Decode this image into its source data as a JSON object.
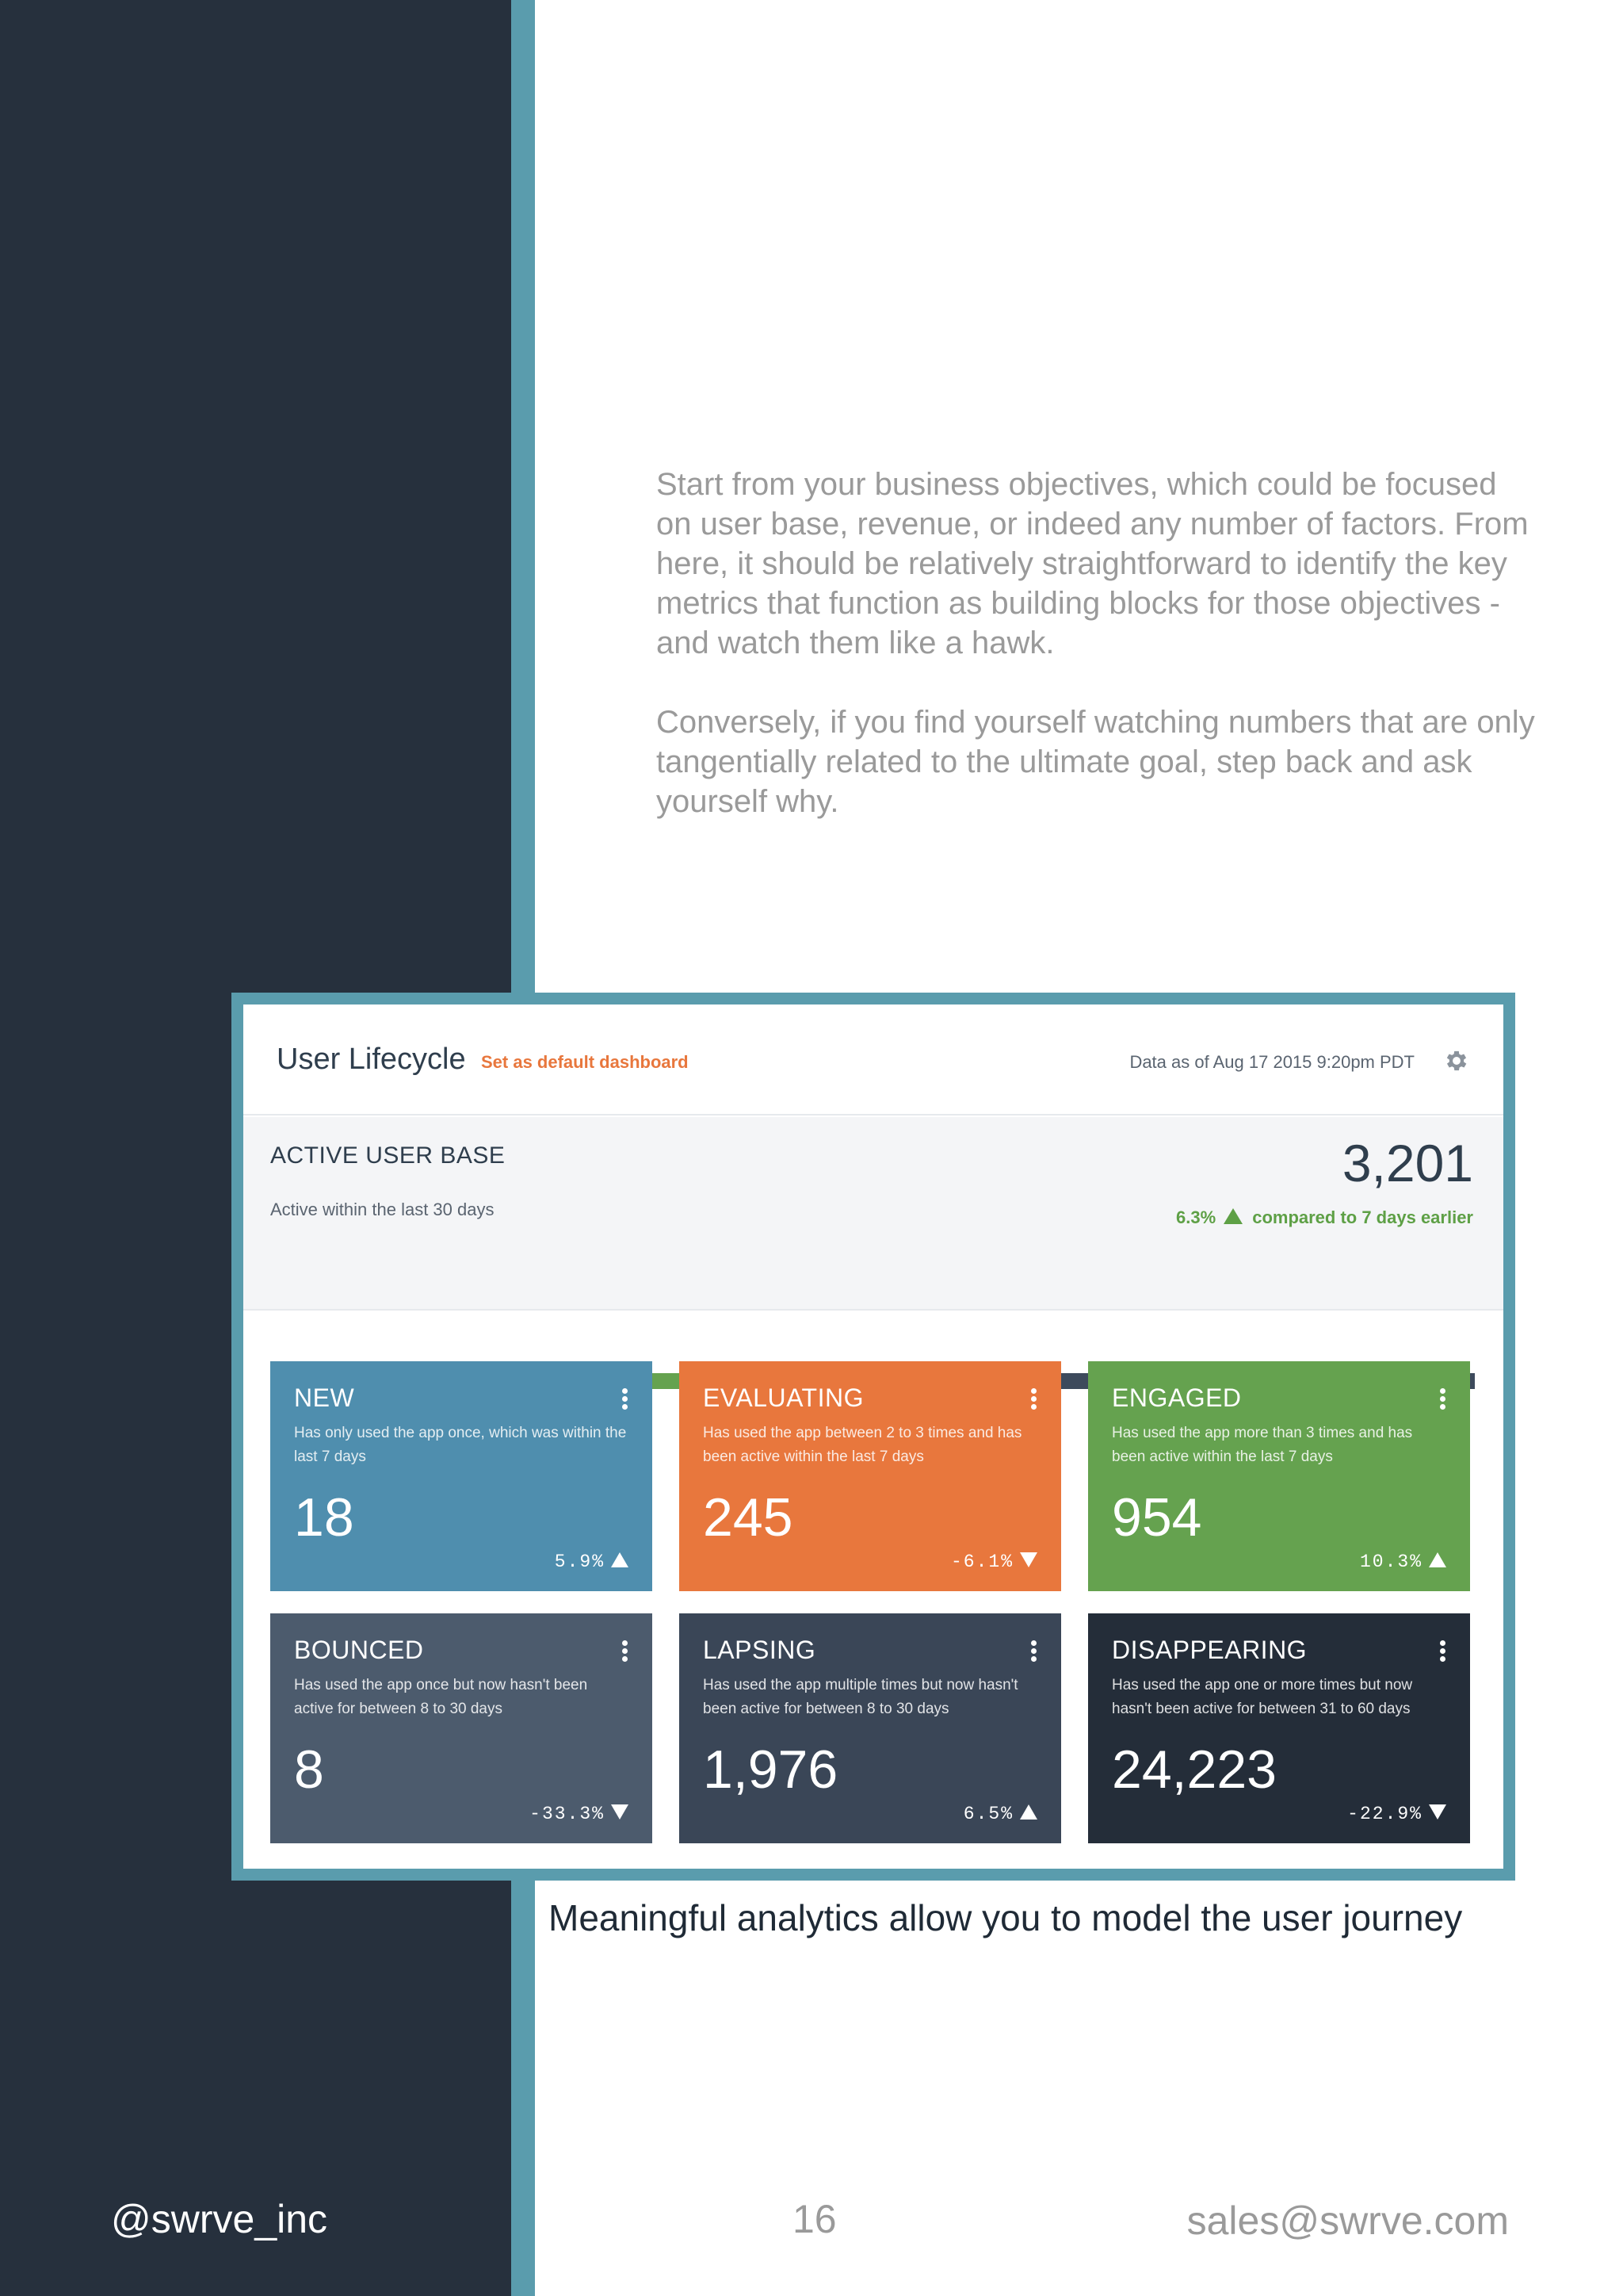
{
  "body_text": {
    "paragraph_1": "Start from your business objectives, which could be focused on user base, revenue, or indeed any number of factors. From here, it should be relatively straightforward to identify the key metrics that function as building blocks for those objectives - and watch them like a hawk.",
    "paragraph_2": "Conversely, if you find yourself watching numbers that are only tangentially related to the ultimate goal, step back and ask yourself why."
  },
  "dashboard": {
    "title": "User Lifecycle",
    "default_link": "Set as default dashboard",
    "data_as_of": "Data as of Aug 17 2015 9:20pm PDT",
    "settings_icon": "gear-icon",
    "active_user_base": {
      "label": "ACTIVE USER BASE",
      "subtitle": "Active within the last 30 days",
      "value": "3,201",
      "change": "6.3%",
      "change_direction": "up",
      "comparison": "compared to 7 days earlier",
      "change_color": "#5ea046"
    },
    "lifecycle_bar": [
      {
        "name": "new",
        "share": 0.006,
        "color": "#4f8eae"
      },
      {
        "name": "evaluating",
        "share": 0.077,
        "color": "#e8773d"
      },
      {
        "name": "engaged",
        "share": 0.298,
        "color": "#65a24f"
      },
      {
        "name": "other",
        "share": 0.619,
        "color": "#3d4a5c"
      }
    ],
    "cards": [
      {
        "name": "NEW",
        "description": "Has only used the app once, which was within the last 7 days",
        "value": "18",
        "change": "5.9%",
        "direction": "up",
        "color": "#4f8eae"
      },
      {
        "name": "EVALUATING",
        "description": "Has used the app between 2 to 3 times and has been active within the last 7 days",
        "value": "245",
        "change": "-6.1%",
        "direction": "down",
        "color": "#e8773d"
      },
      {
        "name": "ENGAGED",
        "description": "Has used the app more than 3 times and has been active within the last 7 days",
        "value": "954",
        "change": "10.3%",
        "direction": "up",
        "color": "#65a24f"
      },
      {
        "name": "BOUNCED",
        "description": "Has used the app once but now hasn't been active for between 8 to 30 days",
        "value": "8",
        "change": "-33.3%",
        "direction": "down",
        "color": "#4c5b6d"
      },
      {
        "name": "LAPSING",
        "description": "Has used the app multiple times but now hasn't been active for between 8 to 30 days",
        "value": "1,976",
        "change": "6.5%",
        "direction": "up",
        "color": "#3a4657"
      },
      {
        "name": "DISAPPEARING",
        "description": "Has used the app one or more times but now hasn't been active for between 31 to 60 days",
        "value": "24,223",
        "change": "-22.9%",
        "direction": "down",
        "color": "#242d39"
      }
    ]
  },
  "caption": "Meaningful analytics allow you to model the user journey",
  "footer": {
    "handle": "@swrve_inc",
    "page_number": "16",
    "email": "sales@swrve.com"
  }
}
